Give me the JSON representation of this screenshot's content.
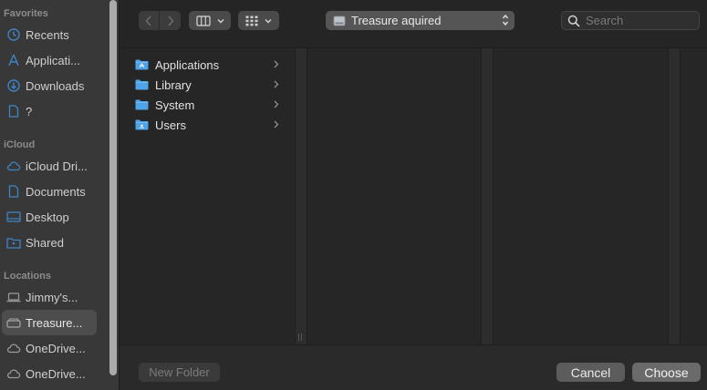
{
  "sidebar": {
    "sections": {
      "favorites": "Favorites",
      "icloud": "iCloud",
      "locations": "Locations"
    },
    "items": [
      {
        "label": "Recents",
        "icon": "clock-icon"
      },
      {
        "label": "Applicati...",
        "icon": "apps-icon"
      },
      {
        "label": "Downloads",
        "icon": "download-icon"
      },
      {
        "label": "?",
        "icon": "document-icon"
      },
      {
        "label": "iCloud Dri...",
        "icon": "cloud-icon"
      },
      {
        "label": "Documents",
        "icon": "document-icon"
      },
      {
        "label": "Desktop",
        "icon": "desktop-icon"
      },
      {
        "label": "Shared",
        "icon": "shared-folder-icon"
      },
      {
        "label": "Jimmy's...",
        "icon": "laptop-icon"
      },
      {
        "label": "Treasure...",
        "icon": "drive-icon"
      },
      {
        "label": "OneDrive...",
        "icon": "cloud-icon"
      },
      {
        "label": "OneDrive...",
        "icon": "cloud-icon"
      }
    ],
    "selected": "Treasure..."
  },
  "toolbar": {
    "location": "Treasure aquired",
    "search_placeholder": "Search"
  },
  "browser": {
    "column1": [
      {
        "name": "Applications"
      },
      {
        "name": "Library"
      },
      {
        "name": "System"
      },
      {
        "name": "Users"
      }
    ]
  },
  "buttons": {
    "new_folder": "New Folder",
    "cancel": "Cancel",
    "choose": "Choose"
  },
  "colors": {
    "accent_icon": "#3b8fd9",
    "sidebar_icon": "#3f84c6",
    "folder": "#4fa3e8"
  }
}
